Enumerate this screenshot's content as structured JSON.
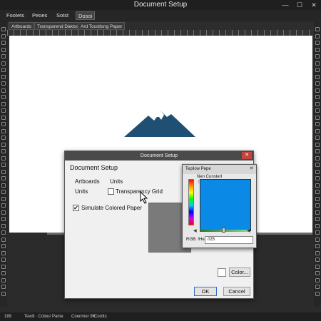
{
  "window": {
    "title": "Document Setup",
    "minimize_icon": "minimize-icon",
    "maximize_icon": "maximize-icon",
    "close_icon": "close-icon"
  },
  "menu": [
    {
      "label": "Footets"
    },
    {
      "label": "Peoes"
    },
    {
      "label": "Sotst"
    },
    {
      "label": "Dosoi"
    }
  ],
  "tabs": [
    {
      "label": "Artboards"
    },
    {
      "label": "Transparend Daktsoz"
    },
    {
      "label": "Ard Tocsttsng Paper"
    }
  ],
  "dialog": {
    "title": "Document Setup",
    "close_label": "✕",
    "heading": "Document Setup",
    "artboards_label": "Artboards",
    "units_top_label": "Units",
    "units_label": "Units",
    "transparency_grid_label": "Transparency Grid",
    "transparency_grid_checked": false,
    "simulate_paper_label": "Simulate Colored Paper",
    "simulate_paper_checked": true,
    "color_button_label": "Color...",
    "ok_label": "OK",
    "cancel_label": "Cancel"
  },
  "picker": {
    "title": "Tepilow Pepe",
    "close_label": "✕",
    "caption": "Nen Cunsterl",
    "rgb_label": "RGB: /Hext:",
    "hex_value": "//25",
    "selected_color": "#0a8ae6"
  },
  "status": {
    "zoom": "189",
    "items": [
      "Tevdt · Colour Pame",
      "Coenmer 9K",
      "Cordts"
    ]
  },
  "colors": {
    "accent_blue": "#0a8ae6",
    "logo": "#1f4f73",
    "close_red": "#c8423e"
  }
}
